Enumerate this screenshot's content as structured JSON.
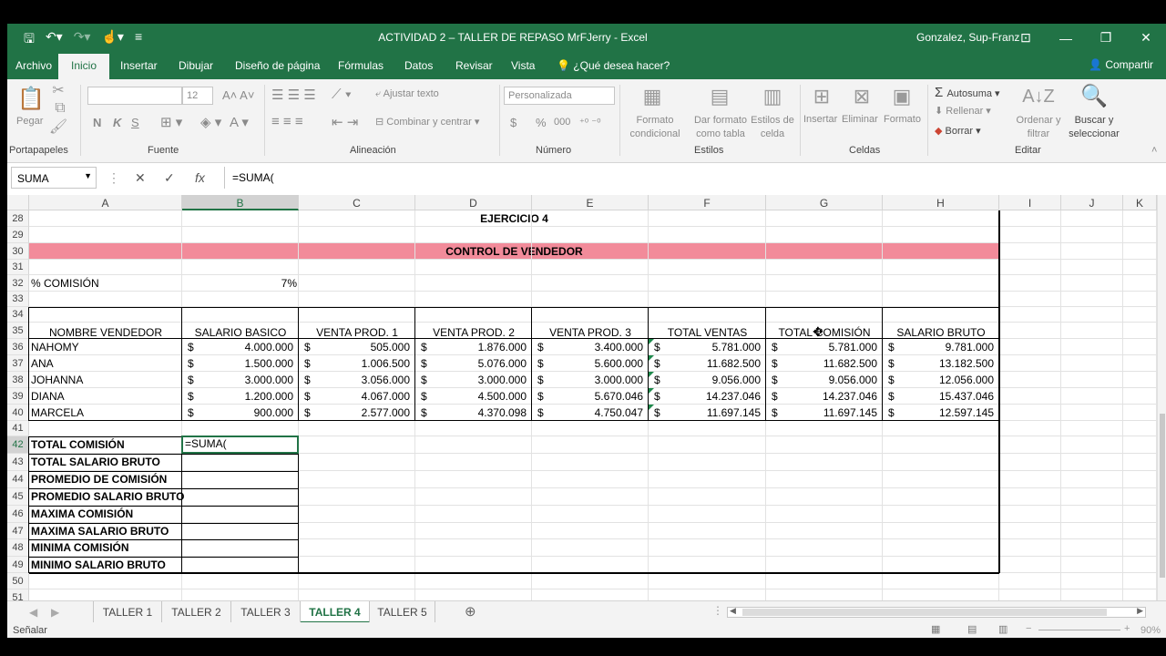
{
  "window": {
    "title": "ACTIVIDAD 2 – TALLER DE REPASO MrFJerry - Excel",
    "user": "Gonzalez, Sup-Franz",
    "controls": [
      "⊡",
      "—",
      "❐",
      "✕"
    ]
  },
  "qat": [
    "save-icon",
    "undo-icon",
    "redo-icon",
    "touch-icon",
    "customize-icon"
  ],
  "menu": {
    "tabs": [
      "Archivo",
      "Inicio",
      "Insertar",
      "Dibujar",
      "Diseño de página",
      "Fórmulas",
      "Datos",
      "Revisar",
      "Vista"
    ],
    "tell_me": "¿Qué desea hacer?",
    "share": "Compartir",
    "active": "Inicio"
  },
  "ribbon": {
    "clipboard": {
      "paste": "Pegar",
      "label": "Portapapeles"
    },
    "font": {
      "size": "12",
      "bold": "N",
      "italic": "K",
      "underline": "S",
      "label": "Fuente"
    },
    "alignment": {
      "wrap": "Ajustar texto",
      "merge": "Combinar y centrar",
      "label": "Alineación"
    },
    "number": {
      "format": "Personalizada",
      "currency": "$",
      "percent": "%",
      "thousands": "000",
      "label": "Número"
    },
    "styles": {
      "cond": "Formato condicional",
      "table": "Dar formato como tabla",
      "cell": "Estilos de celda",
      "label": "Estilos"
    },
    "cells": {
      "insert": "Insertar",
      "delete": "Eliminar",
      "format": "Formato",
      "label": "Celdas"
    },
    "editing": {
      "autosum": "Autosuma",
      "fill": "Rellenar",
      "clear": "Borrar",
      "sort": "Ordenar y filtrar",
      "find": "Buscar y seleccionar",
      "label": "Editar"
    }
  },
  "formula_bar": {
    "name_box": "SUMA",
    "formula": "=SUMA("
  },
  "columns": [
    "A",
    "B",
    "C",
    "D",
    "E",
    "F",
    "G",
    "H",
    "I",
    "J",
    "K"
  ],
  "rows": [
    "28",
    "29",
    "30",
    "31",
    "32",
    "33",
    "34",
    "35",
    "36",
    "37",
    "38",
    "39",
    "40",
    "41",
    "42",
    "43",
    "44",
    "45",
    "46",
    "47",
    "48",
    "49",
    "50",
    "51"
  ],
  "sheet": {
    "exercise_title": "EJERCICIO 4",
    "banner": "CONTROL DE VENDEDOR",
    "banner_color": "#f28b9a",
    "commission_label": "% COMISIÓN",
    "commission_value": "7%",
    "headers": [
      "NOMBRE VENDEDOR",
      "SALARIO BASICO",
      "VENTA PROD. 1",
      "VENTA PROD. 2",
      "VENTA PROD. 3",
      "TOTAL VENTAS",
      "TOTAL COMISIÓN",
      "SALARIO BRUTO"
    ],
    "currency_symbol": "$",
    "data": [
      [
        "NAHOMY",
        "4.000.000",
        "505.000",
        "1.876.000",
        "3.400.000",
        "5.781.000",
        "5.781.000",
        "9.781.000"
      ],
      [
        "ANA",
        "1.500.000",
        "1.006.500",
        "5.076.000",
        "5.600.000",
        "11.682.500",
        "11.682.500",
        "13.182.500"
      ],
      [
        "JOHANNA",
        "3.000.000",
        "3.056.000",
        "3.000.000",
        "3.000.000",
        "9.056.000",
        "9.056.000",
        "12.056.000"
      ],
      [
        "DIANA",
        "1.200.000",
        "4.067.000",
        "4.500.000",
        "5.670.046",
        "14.237.046",
        "14.237.046",
        "15.437.046"
      ],
      [
        "MARCELA",
        "900.000",
        "2.577.000",
        "4.370.098",
        "4.750.047",
        "11.697.145",
        "11.697.145",
        "12.597.145"
      ]
    ],
    "summary_labels": [
      "TOTAL COMISIÓN",
      "TOTAL SALARIO BRUTO",
      "PROMEDIO DE COMISIÓN",
      "PROMEDIO SALARIO BRUTO",
      "MAXIMA COMISIÓN",
      "MAXIMA SALARIO BRUTO",
      "MINIMA COMISIÓN",
      "MINIMO SALARIO BRUTO"
    ],
    "active_cell_value": "=SUMA("
  },
  "sheet_tabs": [
    "TALLER 1",
    "TALLER 2",
    "TALLER 3",
    "TALLER 4",
    "TALLER 5"
  ],
  "active_sheet": "TALLER 4",
  "status": {
    "mode": "Señalar",
    "zoom": "90%"
  }
}
